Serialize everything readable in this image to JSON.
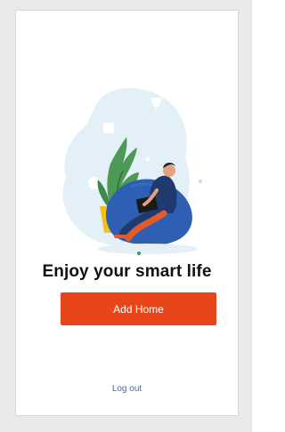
{
  "screen": {
    "headline": "Enjoy your smart life",
    "primary_button_label": "Add Home",
    "logout_link_label": "Log out"
  },
  "illustration": {
    "icon_name": "person-on-beanbag-illustration"
  },
  "colors": {
    "accent": "#e6461a",
    "link": "#3a6db0",
    "blob": "#e3f0f8",
    "beanbag": "#2f5fb3"
  }
}
